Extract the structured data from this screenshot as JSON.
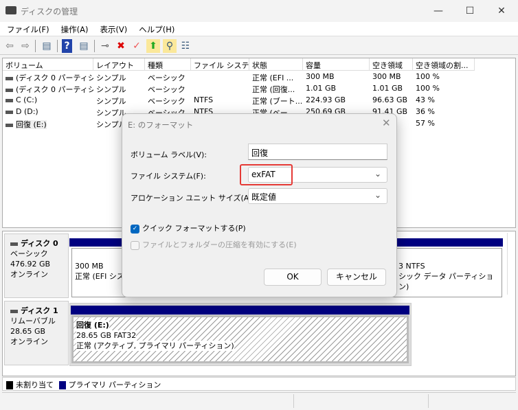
{
  "window": {
    "title": "ディスクの管理",
    "minimize": "—",
    "maximize": "☐",
    "close": "✕"
  },
  "menu": [
    "ファイル(F)",
    "操作(A)",
    "表示(V)",
    "ヘルプ(H)"
  ],
  "toolbar": {
    "back": "⇦",
    "forward": "⇨",
    "console": "▤",
    "help": "?",
    "action": "▤",
    "connect": "⊸",
    "delete": "✖",
    "properties": "✓",
    "up": "⬆",
    "search": "⚲",
    "list": "☷"
  },
  "columns": [
    "ボリューム",
    "レイアウト",
    "種類",
    "ファイル システム",
    "状態",
    "容量",
    "空き領域",
    "空き領域の割..."
  ],
  "rows": [
    [
      "(ディスク 0 パーティシ...",
      "シンプル",
      "ベーシック",
      "",
      "正常 (EFI ...",
      "300 MB",
      "300 MB",
      "100 %"
    ],
    [
      "(ディスク 0 パーティシ...",
      "シンプル",
      "ベーシック",
      "",
      "正常 (回復...",
      "1.01 GB",
      "1.01 GB",
      "100 %"
    ],
    [
      "C (C:)",
      "シンプル",
      "ベーシック",
      "NTFS",
      "正常 (ブート...",
      "224.93 GB",
      "96.63 GB",
      "43 %"
    ],
    [
      "D (D:)",
      "シンプル",
      "ベーシック",
      "NTFS",
      "正常 (ベー",
      "250.69 GB",
      "91.41 GB",
      "36 %"
    ],
    [
      "回復 (E:)",
      "シンプル",
      "",
      "",
      "",
      "",
      "B",
      "57 %"
    ]
  ],
  "disks": [
    {
      "name": "ディスク 0",
      "type": "ベーシック",
      "size": "476.92 GB",
      "status": "オンライン",
      "partitions": [
        {
          "line1": "300 MB",
          "line2": "正常 (EFI シス"
        },
        {
          "line1": "3 NTFS",
          "line2": "シック データ パーティション)"
        }
      ]
    },
    {
      "name": "ディスク 1",
      "type": "リムーバブル",
      "size": "28.65 GB",
      "status": "オンライン",
      "partitions": [
        {
          "line0": "回復  (E:)",
          "line1": "28.65 GB FAT32",
          "line2": "正常 (アクティブ, プライマリ パーティション)"
        }
      ]
    }
  ],
  "legend": [
    {
      "label": "未割り当て",
      "color": "#000000"
    },
    {
      "label": "プライマリ パーティション",
      "color": "#000080"
    }
  ],
  "dialog": {
    "title": "E: のフォーマット",
    "close": "✕",
    "volume_label_label": "ボリューム ラベル(V):",
    "volume_label_value": "回復",
    "filesystem_label": "ファイル システム(F):",
    "filesystem_value": "exFAT",
    "alloc_label": "アロケーション ユニット サイズ(A):",
    "alloc_value": "既定値",
    "quick_format": "クイック フォーマットする(P)",
    "quick_format_checked": true,
    "compression": "ファイルとフォルダーの圧縮を有効にする(E)",
    "compression_checked": false,
    "ok": "OK",
    "cancel": "キャンセル",
    "highlight_color": "#e53935",
    "accent": "#0067c0"
  }
}
